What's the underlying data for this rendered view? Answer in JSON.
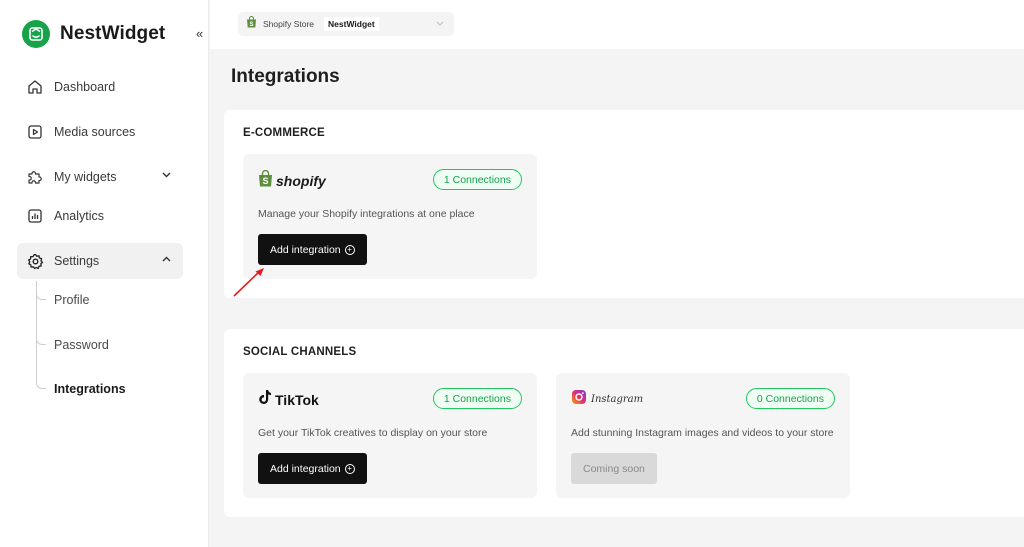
{
  "app": {
    "name": "NestWidget",
    "collapse_glyph": "«"
  },
  "sidebar": {
    "items": [
      {
        "label": "Dashboard",
        "icon": "home-icon"
      },
      {
        "label": "Media sources",
        "icon": "play-square-icon"
      },
      {
        "label": "My widgets",
        "icon": "puzzle-icon",
        "caret": "⌄"
      },
      {
        "label": "Analytics",
        "icon": "bar-chart-icon"
      },
      {
        "label": "Settings",
        "icon": "gear-icon",
        "caret": "⌃",
        "active": true
      }
    ],
    "settings_sub": [
      {
        "label": "Profile"
      },
      {
        "label": "Password"
      },
      {
        "label": "Integrations",
        "active": true
      }
    ]
  },
  "topbar": {
    "store_label": "Shopify Store",
    "store_value": "NestWidget"
  },
  "page": {
    "title": "Integrations"
  },
  "sections": {
    "ecommerce": {
      "title": "E-COMMERCE",
      "shopify": {
        "brand": "shopify",
        "connections": "1 Connections",
        "description": "Manage your Shopify integrations at one place",
        "button": "Add integration"
      }
    },
    "social": {
      "title": "SOCIAL CHANNELS",
      "tiktok": {
        "brand": "TikTok",
        "connections": "1 Connections",
        "description": "Get your TikTok creatives to display on your store",
        "button": "Add integration"
      },
      "instagram": {
        "brand": "Instagram",
        "connections": "0 Connections",
        "description": "Add stunning Instagram images and videos to your store",
        "button": "Coming soon"
      }
    }
  },
  "colors": {
    "brand_green": "#16a34a",
    "connection_pill": "#22c55e",
    "annotation_arrow": "#e11d1d"
  }
}
